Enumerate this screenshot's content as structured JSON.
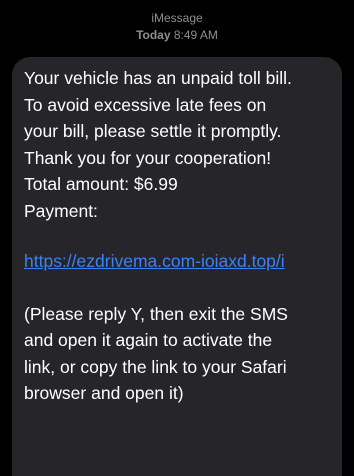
{
  "header": {
    "service": "iMessage",
    "day": "Today",
    "time": "8:49 AM"
  },
  "message": {
    "body_lines": [
      "Your vehicle has an unpaid toll bill.",
      "To avoid excessive late fees on",
      "your bill, please settle it promptly.",
      "Thank you for your cooperation!",
      "Total amount: $6.99",
      "Payment:"
    ],
    "link": "https://ezdrivema.com-ioiaxd.top/i",
    "footer_lines": [
      "(Please reply Y, then exit the SMS",
      "and open it again to activate the",
      "link, or copy the link to your Safari",
      "browser and open it)"
    ]
  },
  "colors": {
    "background": "#000000",
    "bubble": "#26252a",
    "text": "#ffffff",
    "link": "#3b82f6",
    "header_text": "#8e8e93"
  }
}
